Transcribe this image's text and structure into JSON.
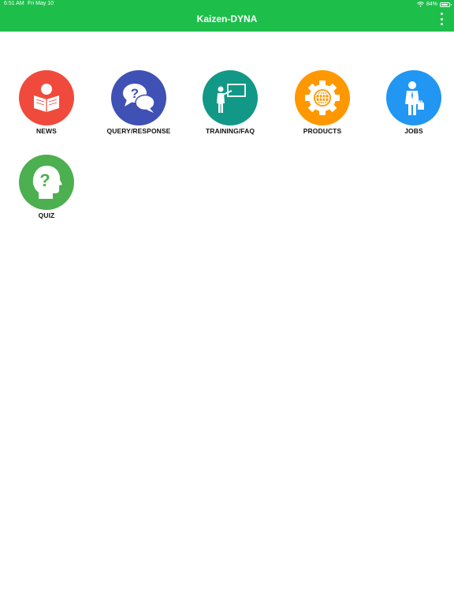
{
  "status_bar": {
    "time": "6:51 AM",
    "date": "Fri May 10",
    "battery_percent": "84%",
    "battery_level": 0.84
  },
  "app_bar": {
    "title": "Kaizen-DYNA",
    "menu_icon": "more-vertical-icon"
  },
  "tiles": [
    {
      "label": "NEWS",
      "icon": "reading-person-icon",
      "color": "#f04a3c"
    },
    {
      "label": "QUERY/RESPONSE",
      "icon": "speech-bubbles-question-icon",
      "color": "#3f51b5"
    },
    {
      "label": "TRAINING/FAQ",
      "icon": "presenter-board-icon",
      "color": "#129886"
    },
    {
      "label": "PRODUCTS",
      "icon": "gear-globe-icon",
      "color": "#ff9800"
    },
    {
      "label": "JOBS",
      "icon": "businessman-icon",
      "color": "#2196f3"
    },
    {
      "label": "QUIZ",
      "icon": "head-question-icon",
      "color": "#4caf50"
    }
  ],
  "colors": {
    "app_bar": "#1ebe4b",
    "background": "#ffffff"
  }
}
